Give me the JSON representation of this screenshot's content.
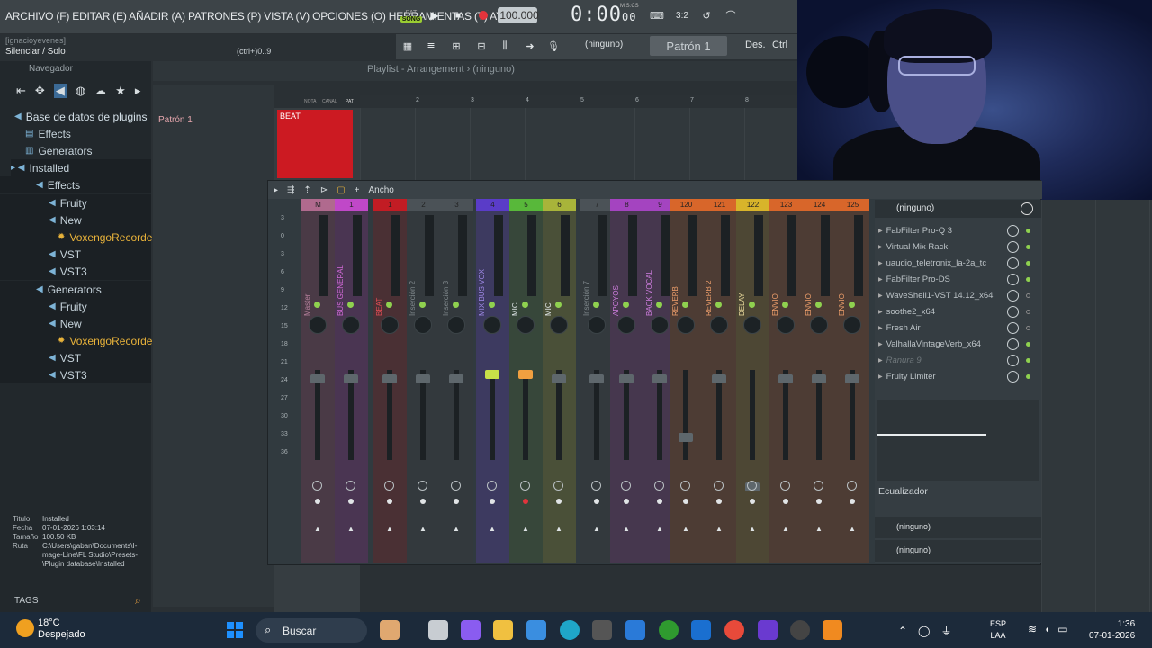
{
  "menu": "ARCHIVO (F) EDITAR (E) AÑADIR (A) PATRONES (P) VISTA (V) OPCIONES (O) HERRAMIENTAS (T) AYUDA",
  "transport": {
    "pat": "PAT",
    "song": "SONG",
    "tempo": "100.000",
    "time": "0:00",
    "time_small": "00",
    "mcs": "M:S:CS"
  },
  "hint": {
    "user": "[ignacioyevenes]",
    "line": "Silenciar / Solo",
    "shortcut": "(ctrl+)0..9"
  },
  "toolbar": {
    "pattern_selector": "(ninguno)",
    "pattern": "Patrón 1",
    "des": "Des.",
    "ctrl": "Ctrl"
  },
  "browser": {
    "title": "Navegador",
    "root": "Base de datos de plugins",
    "items": [
      "Effects",
      "Generators",
      "Installed",
      "Effects",
      "Fruity",
      "New",
      "VoxengoRecorder",
      "VST",
      "VST3",
      "Generators",
      "Fruity",
      "New",
      "VoxengoRecorder",
      "VST",
      "VST3"
    ]
  },
  "info": {
    "titulo_k": "Titulo",
    "titulo": "Installed",
    "fecha_k": "Fecha",
    "fecha": "07-01-2026 1:03:14",
    "tamano_k": "Tamaño",
    "tamano": "100.50 KB",
    "ruta_k": "Ruta",
    "ruta1": "C:\\Users\\gaban\\Documents\\I-",
    "ruta2": "mage-Line\\FL Studio\\Presets-",
    "ruta3": "\\Plugin database\\Installed"
  },
  "tags": "TAGS",
  "playlist": {
    "title": "Playlist - Arrangement › (ninguno)",
    "pattern": "Patrón 1",
    "clip": "BEAT",
    "ruler": [
      "2",
      "3",
      "4",
      "5",
      "6",
      "7",
      "8"
    ],
    "nota": "NOTA",
    "canal": "CANAL",
    "pat": "PAT"
  },
  "mixer": {
    "width_label": "Ancho",
    "db": [
      "3",
      "0",
      "3",
      "6",
      "9",
      "12",
      "15",
      "18",
      "21",
      "24",
      "27",
      "30",
      "33",
      "36"
    ],
    "strips": [
      {
        "num": "M",
        "label": "Master",
        "color": "#b06a8e",
        "bg": "#4a3a46",
        "lc": "#b8829e"
      },
      {
        "num": "1",
        "label": "BUS GENERAL",
        "color": "#c048c8",
        "bg": "#4a3552",
        "lc": "#d36ad8"
      },
      {
        "num": "1",
        "label": "BEAT",
        "color": "#c21c24",
        "bg": "#4a3034",
        "lc": "#e34d55"
      },
      {
        "num": "2",
        "label": "Inserción 2",
        "color": "#4b5257",
        "bg": "#33393d",
        "lc": "#7f878b"
      },
      {
        "num": "3",
        "label": "Inserción 3",
        "color": "#4b5257",
        "bg": "#33393d",
        "lc": "#7f878b"
      },
      {
        "num": "4",
        "label": "MIX BUS VOX",
        "color": "#5a3cc8",
        "bg": "#3d3a60",
        "lc": "#a08ae8"
      },
      {
        "num": "5",
        "label": "MIC",
        "color": "#58b83a",
        "bg": "#37473a",
        "lc": "#e8eef0"
      },
      {
        "num": "6",
        "label": "MIC",
        "color": "#a8b43a",
        "bg": "#4a5038",
        "lc": "#e8eef0"
      },
      {
        "num": "7",
        "label": "Inserción 7",
        "color": "#4b5257",
        "bg": "#33393d",
        "lc": "#7f878b"
      },
      {
        "num": "8",
        "label": "APOYOS",
        "color": "#a444c0",
        "bg": "#46374e",
        "lc": "#d07ee0"
      },
      {
        "num": "9",
        "label": "BACK VOCAL",
        "color": "#a444c0",
        "bg": "#46374e",
        "lc": "#d07ee0"
      },
      {
        "num": "120",
        "label": "REVERB",
        "color": "#d8662a",
        "bg": "#4d3c34",
        "lc": "#ef9f6b"
      },
      {
        "num": "121",
        "label": "REVERB 2",
        "color": "#d8662a",
        "bg": "#4d3c34",
        "lc": "#ef9f6b"
      },
      {
        "num": "122",
        "label": "DELAY",
        "color": "#d8b42a",
        "bg": "#4d4734",
        "lc": "#f0e0a0"
      },
      {
        "num": "123",
        "label": "ENVIO",
        "color": "#d8662a",
        "bg": "#4d3c34",
        "lc": "#ef9f6b"
      },
      {
        "num": "124",
        "label": "ENVIO",
        "color": "#d8662a",
        "bg": "#4d3c34",
        "lc": "#ef9f6b"
      },
      {
        "num": "125",
        "label": "ENVIO",
        "color": "#d8662a",
        "bg": "#4d3c34",
        "lc": "#ef9f6b"
      }
    ]
  },
  "fx": {
    "select": "(ninguno)",
    "slots": [
      {
        "name": "FabFilter Pro-Q 3",
        "on": true
      },
      {
        "name": "Virtual Mix Rack",
        "on": true
      },
      {
        "name": "uaudio_teletronix_la-2a_tc",
        "on": true
      },
      {
        "name": "FabFilter Pro-DS",
        "on": true
      },
      {
        "name": "WaveShell1-VST 14.12_x64",
        "on": false
      },
      {
        "name": "soothe2_x64",
        "on": false
      },
      {
        "name": "Fresh Air",
        "on": false
      },
      {
        "name": "ValhallaVintageVerb_x64",
        "on": true
      },
      {
        "name": "Ranura 9",
        "on": true,
        "dim": true
      },
      {
        "name": "Fruity Limiter",
        "on": true
      }
    ],
    "eq": "Ecualizador",
    "out1": "(ninguno)",
    "out2": "(ninguno)"
  },
  "taskbar": {
    "temp": "18°C",
    "weather": "Despejado",
    "search": "Buscar",
    "lang1": "ESP",
    "lang2": "LAA",
    "time": "1:36",
    "date": "07-01-2026"
  }
}
